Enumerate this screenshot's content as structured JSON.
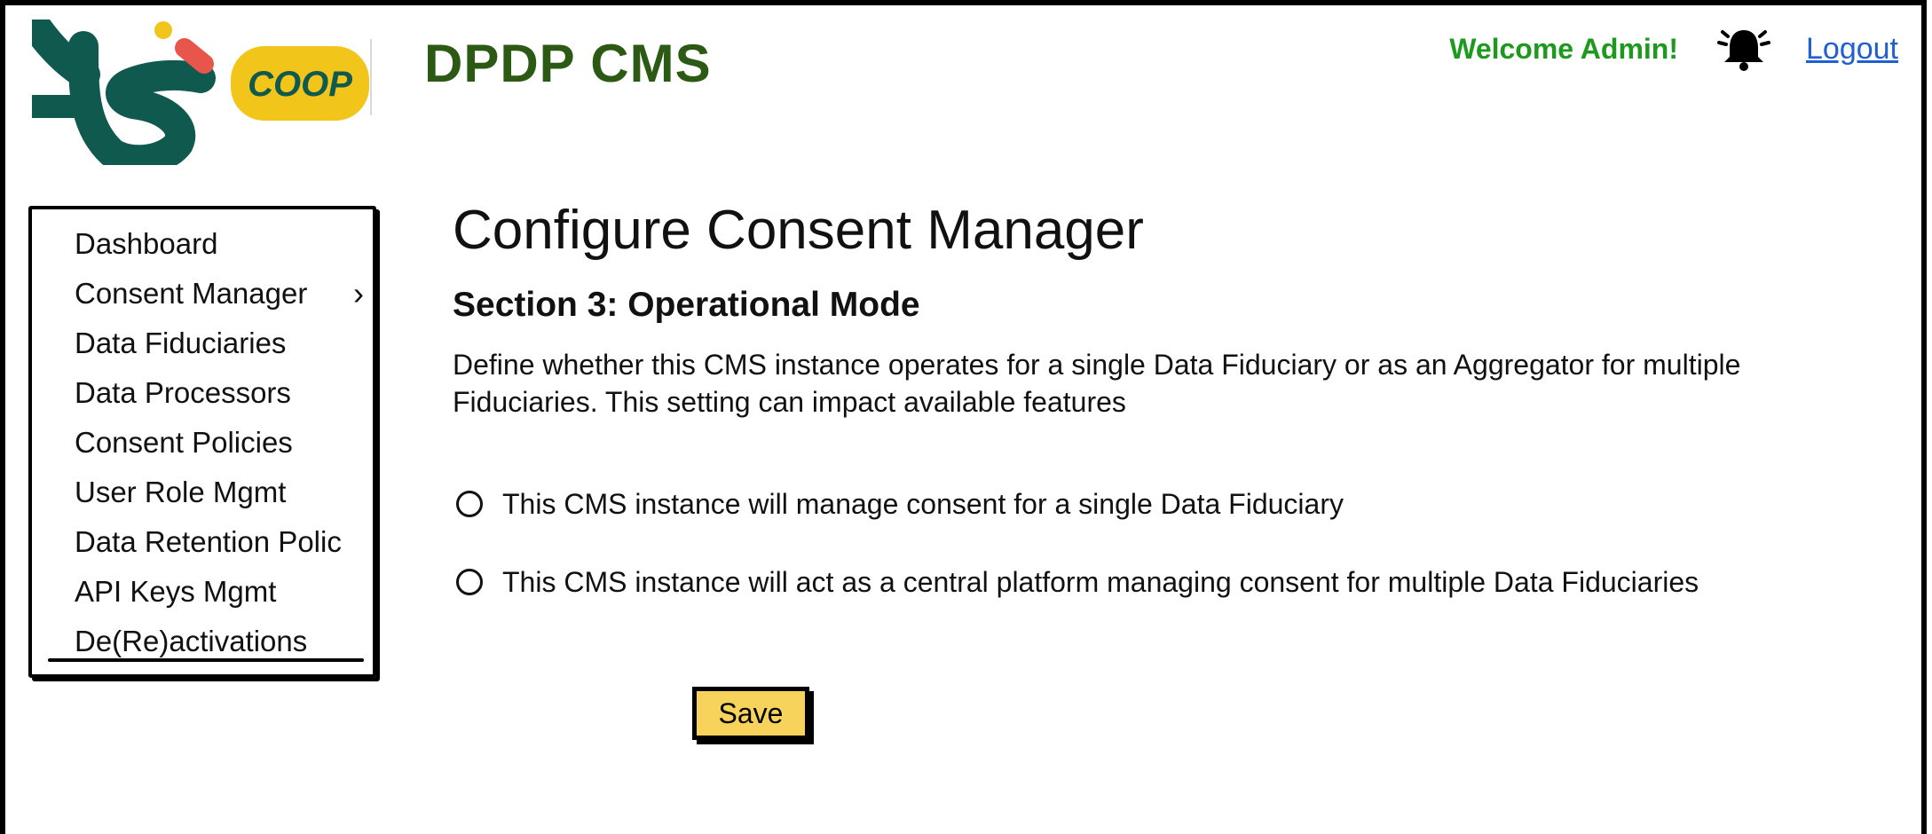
{
  "header": {
    "logo": {
      "text": "COOP",
      "colors": {
        "green": "#10594f",
        "yellow": "#f2c51b",
        "coral": "#e8564b"
      }
    },
    "app_title": "DPDP CMS",
    "welcome_text": "Welcome Admin!",
    "bell_icon": "bell-icon",
    "logout_label": "Logout"
  },
  "sidebar": {
    "items": [
      {
        "label": "Dashboard"
      },
      {
        "label": "Consent Manager",
        "has_submenu": true
      },
      {
        "label": "Data Fiduciaries"
      },
      {
        "label": "Data Processors"
      },
      {
        "label": "Consent Policies"
      },
      {
        "label": "User Role Mgmt"
      },
      {
        "label": "Data Retention Polic"
      },
      {
        "label": "API Keys Mgmt"
      },
      {
        "label": "De(Re)activations"
      }
    ]
  },
  "main": {
    "page_title": "Configure Consent Manager",
    "section_title": "Section 3: Operational Mode",
    "section_description": "Define whether this CMS instance operates for a single Data Fiduciary or as an Aggregator for multiple Fiduciaries. This setting can impact available features",
    "options": [
      {
        "label": "This CMS instance will manage consent for a single Data Fiduciary",
        "selected": false
      },
      {
        "label": "This CMS instance will act as a central platform managing consent for multiple Data Fiduciaries",
        "selected": false
      }
    ],
    "save_label": "Save"
  },
  "colors": {
    "title_green": "#2c5a14",
    "welcome_green": "#1d9a1d",
    "link_blue": "#1f5fd0",
    "save_yellow": "#f7d35b"
  }
}
